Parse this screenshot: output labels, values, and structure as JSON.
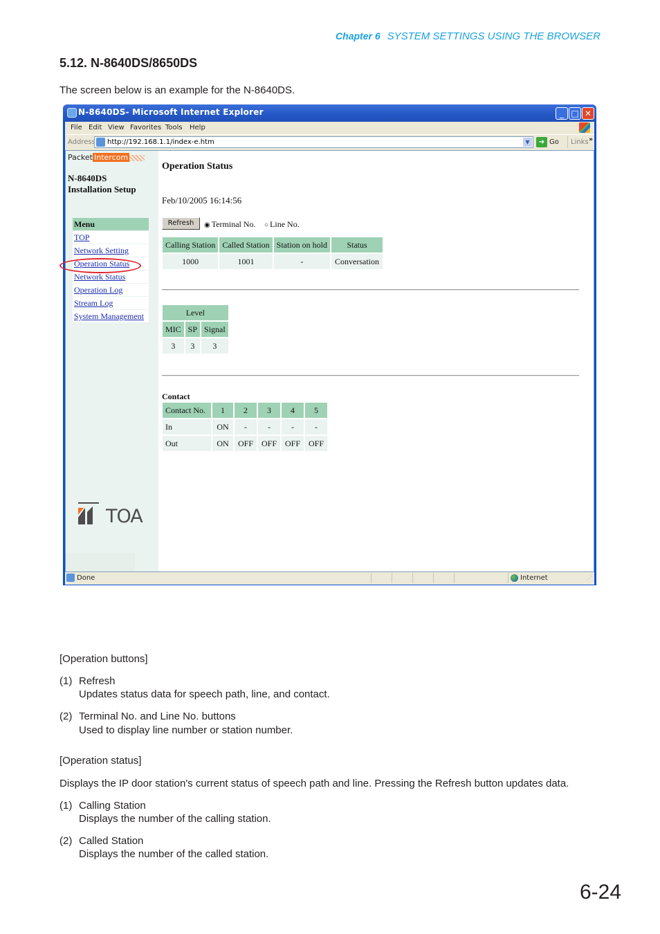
{
  "header": {
    "chapter_label": "Chapter 6",
    "chapter_title": "SYSTEM SETTINGS USING THE BROWSER",
    "section_title": "5.12. N-8640DS/8650DS",
    "intro": "The screen below is an example for the N-8640DS."
  },
  "browser": {
    "title": "N-8640DS- Microsoft Internet Explorer",
    "menu": [
      "File",
      "Edit",
      "View",
      "Favorites",
      "Tools",
      "Help"
    ],
    "address_label": "Address",
    "url": "http://192.168.1.1/index-e.htm",
    "go_label": "Go",
    "links_label": "Links",
    "status_text": "Done",
    "zone_text": "Internet"
  },
  "sidebar": {
    "brand_a": "Packet",
    "brand_b": "Intercom",
    "device_model": "N-8640DS",
    "device_subtitle": "Installation Setup",
    "menu_header": "Menu",
    "items": [
      {
        "label": "TOP"
      },
      {
        "label": "Network Setting"
      },
      {
        "label": "Operation Status"
      },
      {
        "label": "Network Status"
      },
      {
        "label": "Operation Log"
      },
      {
        "label": "Stream Log"
      },
      {
        "label": "System Management"
      }
    ],
    "logo_text": "TOA",
    "accent_color": "#e0202a"
  },
  "main": {
    "title": "Operation Status",
    "timestamp": "Feb/10/2005 16:14:56",
    "refresh_label": "Refresh",
    "radio_terminal": "Terminal No.",
    "radio_line": "Line No.",
    "radio_selected": "Terminal No.",
    "status_table": {
      "headers": [
        "Calling Station",
        "Called Station",
        "Station on hold",
        "Status"
      ],
      "row": [
        "1000",
        "1001",
        "-",
        "Conversation"
      ]
    },
    "level_table": {
      "title": "Level",
      "headers": [
        "MIC",
        "SP",
        "Signal"
      ],
      "row": [
        "3",
        "3",
        "3"
      ]
    },
    "contact": {
      "title": "Contact",
      "headers": [
        "Contact No.",
        "1",
        "2",
        "3",
        "4",
        "5"
      ],
      "rows": [
        [
          "In",
          "ON",
          "-",
          "-",
          "-",
          "-"
        ],
        [
          "Out",
          "ON",
          "OFF",
          "OFF",
          "OFF",
          "OFF"
        ]
      ]
    }
  },
  "doc": {
    "ops_buttons_heading": "[Operation buttons]",
    "b1_num": "(1)",
    "b1_title": "Refresh",
    "b1_desc": "Updates status data for speech path, line, and contact.",
    "b2_num": "(2)",
    "b2_title": "Terminal No. and Line No. buttons",
    "b2_desc": "Used to display line number or station number.",
    "ops_status_heading": "[Operation status]",
    "ops_status_desc": "Displays the IP door station's current status of speech path and line. Pressing the Refresh button updates data.",
    "s1_num": "(1)",
    "s1_title": "Calling Station",
    "s1_desc": "Displays the number of the calling station.",
    "s2_num": "(2)",
    "s2_title": "Called Station",
    "s2_desc": "Displays the number of the called station.",
    "page_number": "6-24"
  }
}
